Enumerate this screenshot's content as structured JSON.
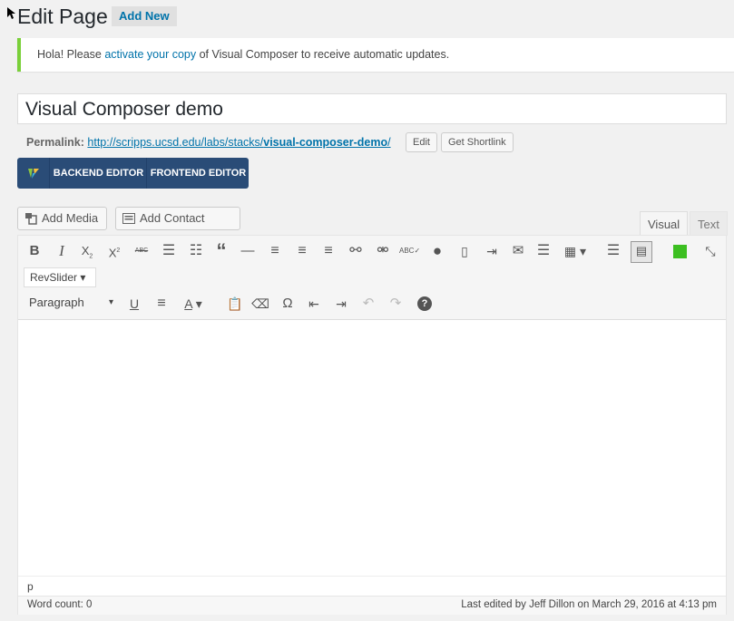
{
  "header": {
    "title": "Edit Page",
    "add_new": "Add New"
  },
  "notice": {
    "text_before": "Hola! Please ",
    "link": "activate your copy",
    "text_after": " of Visual Composer to receive automatic updates.",
    "accent": "#7ad03a"
  },
  "post": {
    "title": "Visual Composer demo"
  },
  "permalink": {
    "label": "Permalink:",
    "url_base": "http://scripps.ucsd.edu/labs/stacks/",
    "slug": "visual-composer-demo",
    "url_end": "/",
    "edit": "Edit",
    "shortlink": "Get Shortlink"
  },
  "vc": {
    "backend": "BACKEND EDITOR",
    "frontend": "FRONTEND EDITOR",
    "bg": "#2a4c77"
  },
  "media": {
    "add_media": "Add Media",
    "add_contact_form": "Add Contact Form"
  },
  "tabs": {
    "visual": "Visual",
    "text": "Text"
  },
  "toolbar": {
    "row1_icons": [
      "bold-icon",
      "italic-icon",
      "subscript-icon",
      "superscript-icon",
      "strikethrough-icon",
      "bullet-list-icon",
      "numbered-list-icon",
      "blockquote-icon",
      "horizontal-rule-icon",
      "align-left-icon",
      "align-center-icon",
      "align-right-icon",
      "link-icon",
      "unlink-icon",
      "spellcheck-icon",
      "globe-icon",
      "bookmark-icon",
      "insert-more-icon",
      "email-icon",
      "justify-icon",
      "table-icon",
      "toolbar-toggle-icon",
      "keyboard-icon",
      "green-box-icon",
      "fullscreen-icon"
    ],
    "revslider": "RevSlider",
    "format": "Paragraph",
    "row3_icons": [
      "underline-icon",
      "align-justify-icon",
      "text-color-icon",
      "paste-text-icon",
      "clear-format-icon",
      "special-char-icon",
      "outdent-icon",
      "indent-icon",
      "undo-icon",
      "redo-icon",
      "help-icon"
    ]
  },
  "editor": {
    "path": "p",
    "word_count": "Word count: 0",
    "last_edited": "Last edited by Jeff Dillon on March 29, 2016 at 4:13 pm"
  }
}
